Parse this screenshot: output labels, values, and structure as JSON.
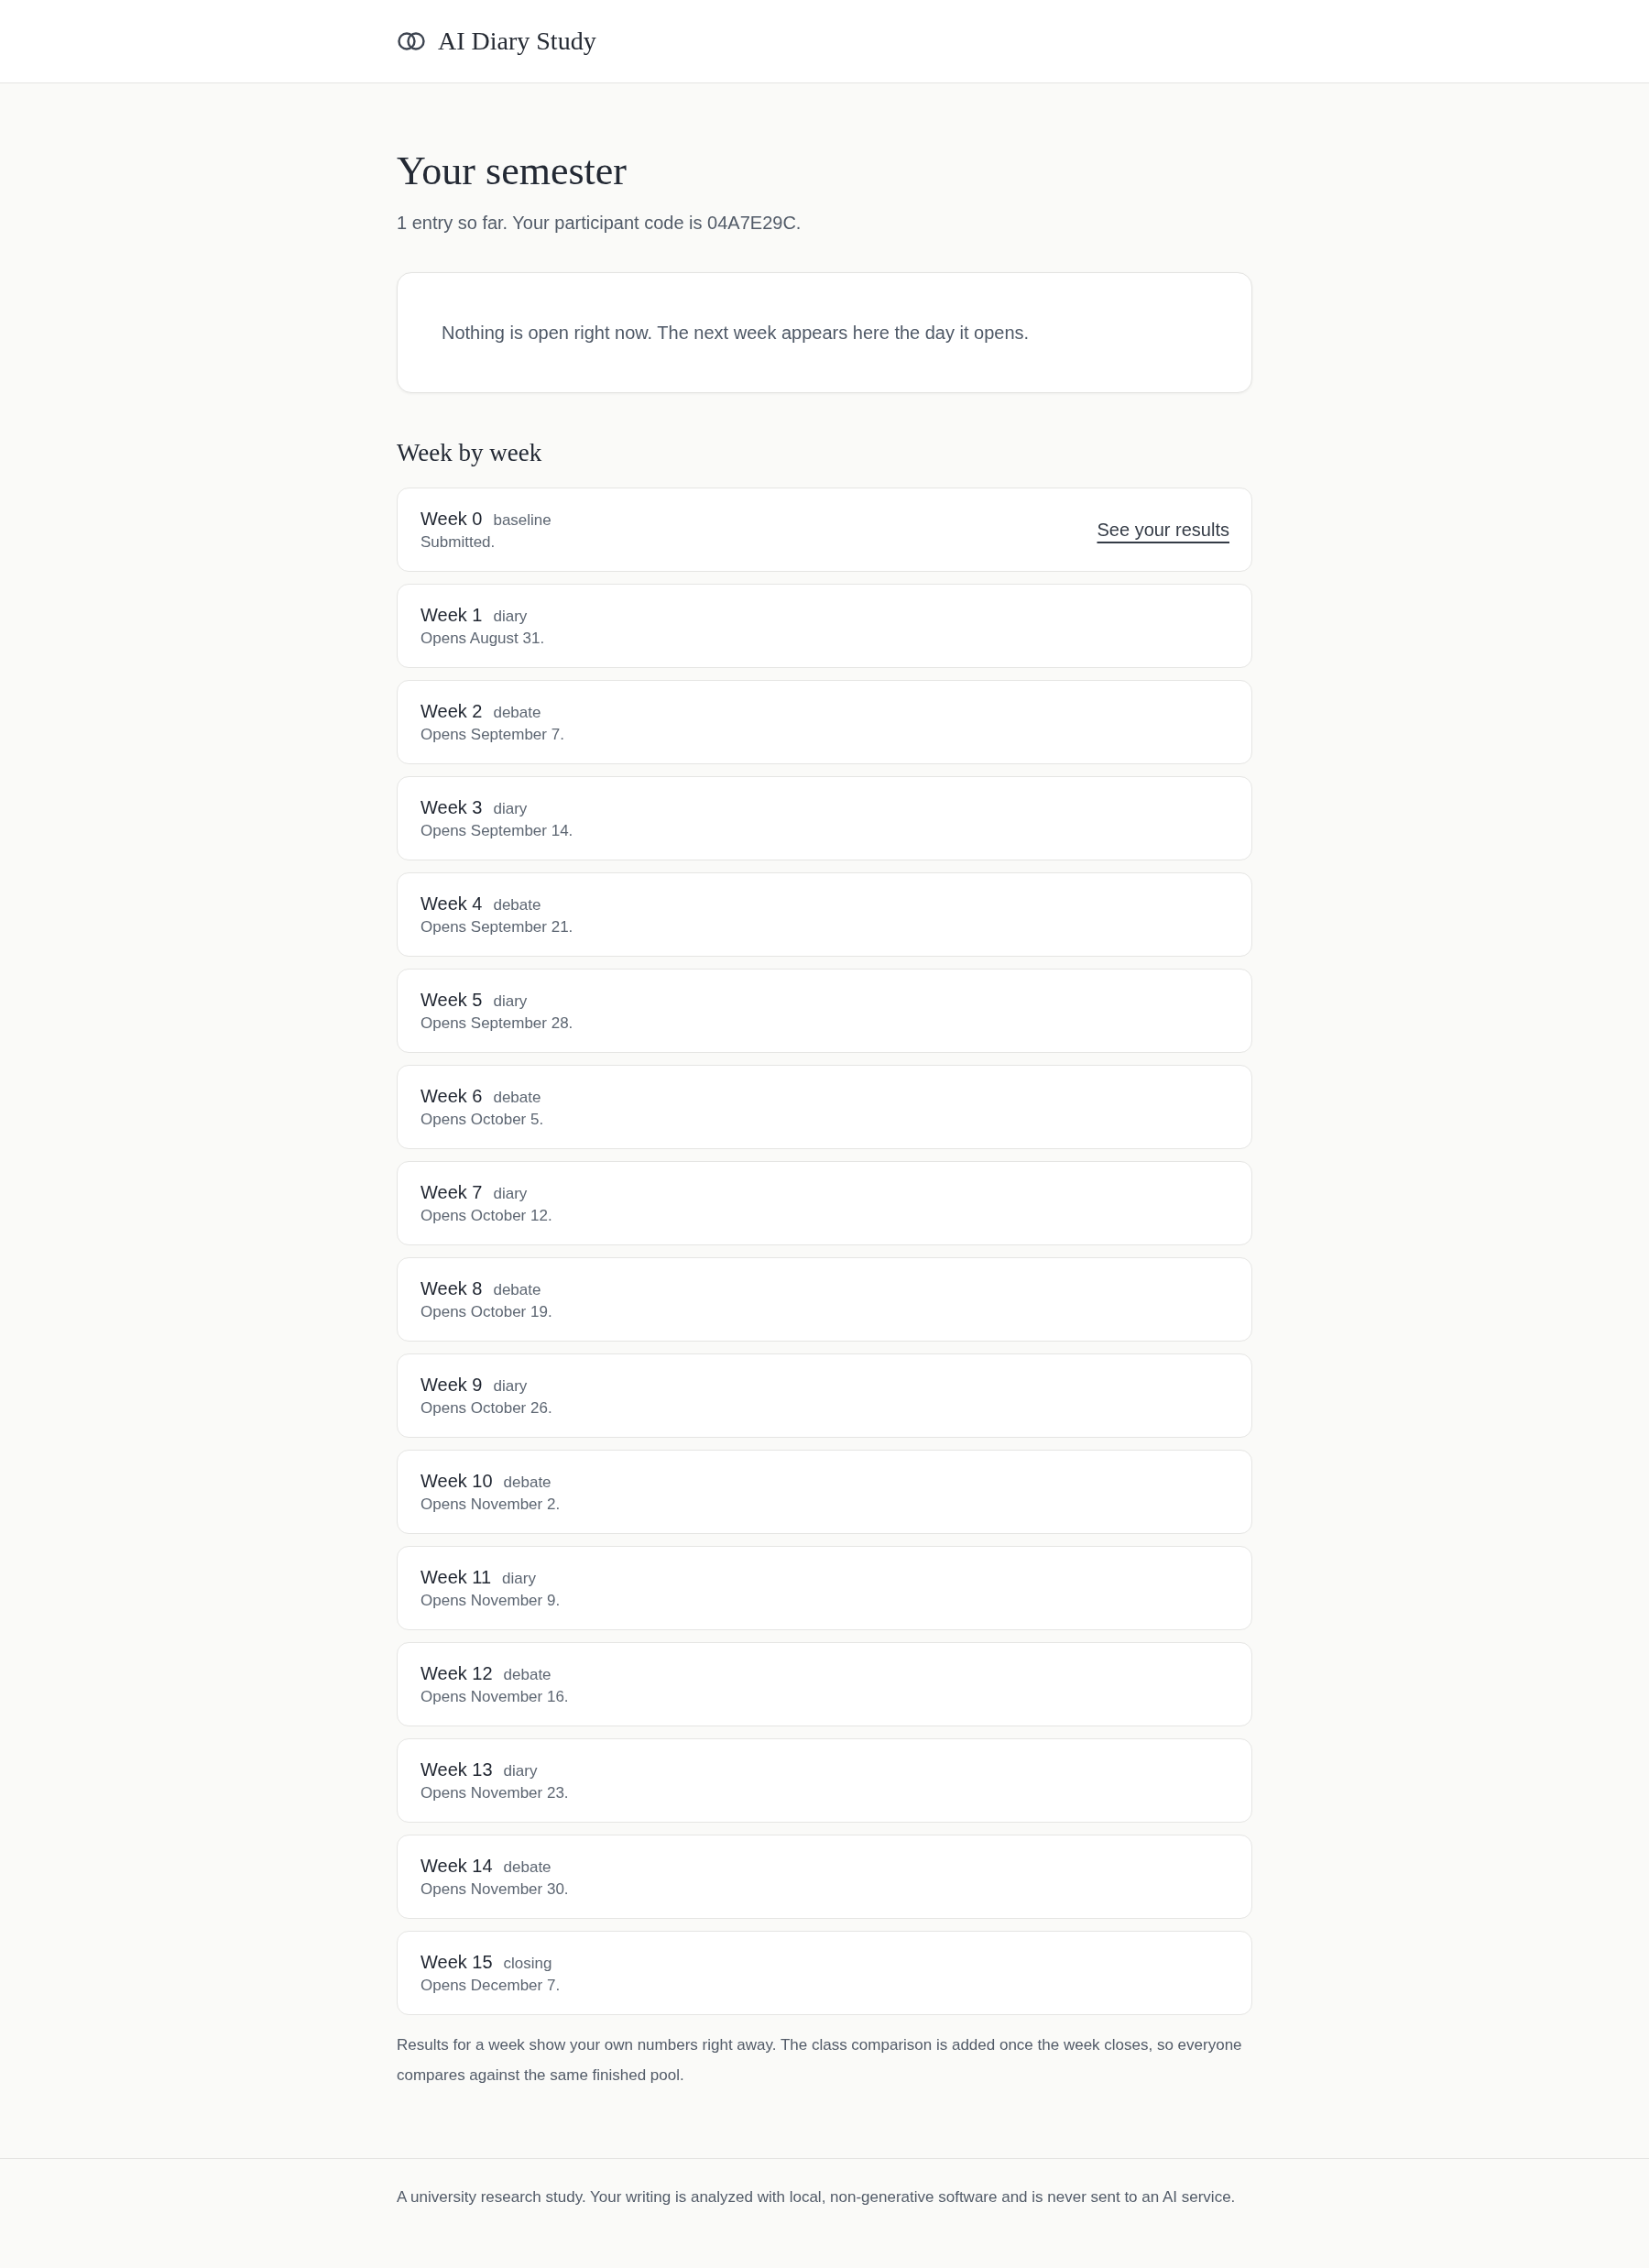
{
  "header": {
    "brand": "AI Diary Study"
  },
  "page": {
    "title": "Your semester",
    "subtitle": "1 entry so far. Your participant code is 04A7E29C."
  },
  "notice": {
    "text": "Nothing is open right now. The next week appears here the day it opens."
  },
  "weeks_section": {
    "heading": "Week by week",
    "weeks": [
      {
        "title": "Week 0",
        "tag": "baseline",
        "status": "Submitted.",
        "link": "See your results"
      },
      {
        "title": "Week 1",
        "tag": "diary",
        "status": "Opens August 31."
      },
      {
        "title": "Week 2",
        "tag": "debate",
        "status": "Opens September 7."
      },
      {
        "title": "Week 3",
        "tag": "diary",
        "status": "Opens September 14."
      },
      {
        "title": "Week 4",
        "tag": "debate",
        "status": "Opens September 21."
      },
      {
        "title": "Week 5",
        "tag": "diary",
        "status": "Opens September 28."
      },
      {
        "title": "Week 6",
        "tag": "debate",
        "status": "Opens October 5."
      },
      {
        "title": "Week 7",
        "tag": "diary",
        "status": "Opens October 12."
      },
      {
        "title": "Week 8",
        "tag": "debate",
        "status": "Opens October 19."
      },
      {
        "title": "Week 9",
        "tag": "diary",
        "status": "Opens October 26."
      },
      {
        "title": "Week 10",
        "tag": "debate",
        "status": "Opens November 2."
      },
      {
        "title": "Week 11",
        "tag": "diary",
        "status": "Opens November 9."
      },
      {
        "title": "Week 12",
        "tag": "debate",
        "status": "Opens November 16."
      },
      {
        "title": "Week 13",
        "tag": "diary",
        "status": "Opens November 23."
      },
      {
        "title": "Week 14",
        "tag": "debate",
        "status": "Opens November 30."
      },
      {
        "title": "Week 15",
        "tag": "closing",
        "status": "Opens December 7."
      }
    ],
    "note": "Results for a week show your own numbers right away. The class comparison is added once the week closes, so everyone compares against the same finished pool."
  },
  "footer": {
    "text": "A university research study. Your writing is analyzed with local, non-generative software and is never sent to an AI service."
  }
}
